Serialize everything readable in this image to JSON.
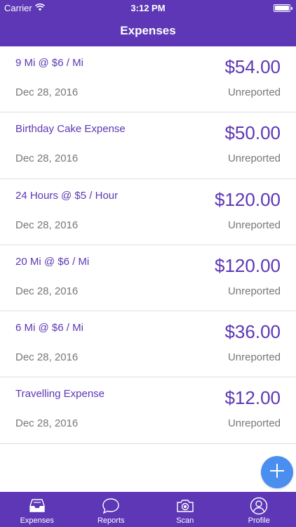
{
  "status_bar": {
    "carrier": "Carrier",
    "time": "3:12 PM",
    "battery_level": 1.0
  },
  "nav": {
    "title": "Expenses"
  },
  "expenses": [
    {
      "title": "9 Mi @ $6 / Mi",
      "amount": "$54.00",
      "date": "Dec 28, 2016",
      "status": "Unreported"
    },
    {
      "title": "Birthday Cake Expense",
      "amount": "$50.00",
      "date": "Dec 28, 2016",
      "status": "Unreported"
    },
    {
      "title": "24 Hours @ $5 / Hour",
      "amount": "$120.00",
      "date": "Dec 28, 2016",
      "status": "Unreported"
    },
    {
      "title": "20 Mi @ $6 / Mi",
      "amount": "$120.00",
      "date": "Dec 28, 2016",
      "status": "Unreported"
    },
    {
      "title": "6 Mi @ $6 / Mi",
      "amount": "$36.00",
      "date": "Dec 28, 2016",
      "status": "Unreported"
    },
    {
      "title": "Travelling Expense",
      "amount": "$12.00",
      "date": "Dec 28, 2016",
      "status": "Unreported"
    }
  ],
  "fab": {
    "icon": "plus-icon"
  },
  "tabbar": {
    "tabs": [
      {
        "label": "Expenses",
        "icon": "inbox-tray-icon"
      },
      {
        "label": "Reports",
        "icon": "chat-bubble-icon"
      },
      {
        "label": "Scan",
        "icon": "camera-icon"
      },
      {
        "label": "Profile",
        "icon": "user-icon"
      }
    ]
  },
  "colors": {
    "brand_purple": "#5d37b5",
    "fab_blue": "#4a8ef0",
    "muted_text": "#777777",
    "divider": "#dedede"
  }
}
